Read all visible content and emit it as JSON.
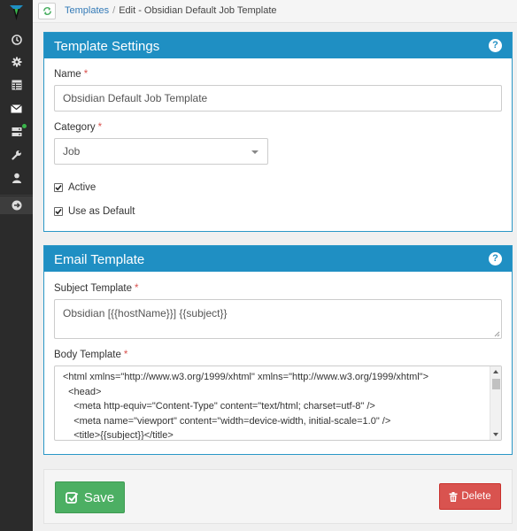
{
  "sidebar": {
    "logo_icon": "brand-logo-icon",
    "items": [
      {
        "icon": "clock-icon",
        "badge": false
      },
      {
        "icon": "gear-icon",
        "badge": false
      },
      {
        "icon": "table-icon",
        "badge": false
      },
      {
        "icon": "envelope-icon",
        "badge": false
      },
      {
        "icon": "server-icon",
        "badge": true
      },
      {
        "icon": "wrench-icon",
        "badge": false
      },
      {
        "icon": "user-icon",
        "badge": false
      },
      {
        "icon": "arrow-circle-icon",
        "badge": false
      }
    ]
  },
  "breadcrumb": {
    "link": "Templates",
    "separator": "/",
    "current": "Edit - Obsidian Default Job Template"
  },
  "template_settings": {
    "title": "Template Settings",
    "help": "?",
    "name_label": "Name",
    "name_value": "Obsidian Default Job Template",
    "category_label": "Category",
    "category_value": "Job",
    "active_label": "Active",
    "active_checked": true,
    "default_label": "Use as Default",
    "default_checked": true,
    "required_mark": "*"
  },
  "email_template": {
    "title": "Email Template",
    "help": "?",
    "subject_label": "Subject Template",
    "subject_value": "Obsidian [{{hostName}}] {{subject}}",
    "body_label": "Body Template",
    "body_lines": [
      "<html xmlns=\"http://www.w3.org/1999/xhtml\" xmlns=\"http://www.w3.org/1999/xhtml\">",
      "  <head>",
      "    <meta http-equiv=\"Content-Type\" content=\"text/html; charset=utf-8\" />",
      "    <meta name=\"viewport\" content=\"width=device-width, initial-scale=1.0\" />",
      "    <title>{{subject}}</title>"
    ],
    "required_mark": "*"
  },
  "actions": {
    "save_label": "Save",
    "delete_label": "Delete"
  },
  "colors": {
    "panel_header": "#1f8fc3",
    "save": "#4caf63",
    "delete": "#d9534f",
    "sidebar": "#2b2b2b",
    "link": "#337ab7"
  }
}
